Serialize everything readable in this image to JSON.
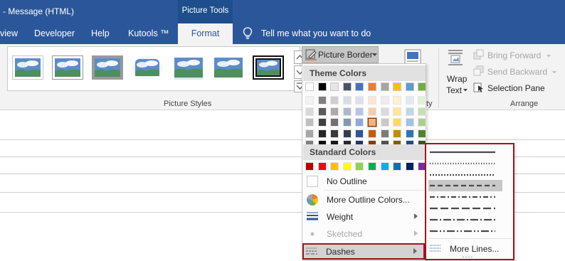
{
  "window": {
    "title": "- Message (HTML)"
  },
  "context_tab": {
    "label": "Picture Tools"
  },
  "tabs": [
    {
      "label": "view"
    },
    {
      "label": "Developer"
    },
    {
      "label": "Help"
    },
    {
      "label": "Kutools ™"
    },
    {
      "label": "Format"
    }
  ],
  "tell_me": {
    "label": "Tell me what you want to do"
  },
  "ribbon": {
    "picture_styles_label": "Picture Styles",
    "picture_border_label": "Picture Border",
    "y_partial_label": "ty",
    "wrap_text_label_1": "Wrap",
    "wrap_text_label_2": "Text",
    "bring_forward_label": "Bring Forward",
    "send_backward_label": "Send Backward",
    "selection_pane_label": "Selection Pane",
    "arrange_label": "Arrange"
  },
  "menu": {
    "theme_colors_label": "Theme Colors",
    "theme_top_row": [
      "#ffffff",
      "#000000",
      "#e7e6e6",
      "#44546a",
      "#4472c4",
      "#ed7d31",
      "#a5a5a5",
      "#ffc000",
      "#5b9bd5",
      "#70ad47"
    ],
    "theme_columns": [
      [
        "#f2f2f2",
        "#d9d9d9",
        "#bfbfbf",
        "#a6a6a6",
        "#808080"
      ],
      [
        "#808080",
        "#595959",
        "#404040",
        "#262626",
        "#0d0d0d"
      ],
      [
        "#d0cece",
        "#aeaaaa",
        "#757070",
        "#3a3838",
        "#161616"
      ],
      [
        "#d6dce4",
        "#acb9ca",
        "#8497b0",
        "#333f4f",
        "#222a35"
      ],
      [
        "#d9e1f2",
        "#b4c6e7",
        "#8ea9db",
        "#2f5597",
        "#1f3864"
      ],
      [
        "#fbe5d6",
        "#f8cbad",
        "#f4b183",
        "#c55a11",
        "#843c0c"
      ],
      [
        "#ededed",
        "#dbdbdb",
        "#c9c9c9",
        "#7b7b7b",
        "#525252"
      ],
      [
        "#fff2cc",
        "#ffe699",
        "#ffd966",
        "#bf9000",
        "#7f6000"
      ],
      [
        "#deebf7",
        "#bdd7ee",
        "#9dc3e6",
        "#2e75b6",
        "#1f4e79"
      ],
      [
        "#e2f0d9",
        "#c5e0b4",
        "#a9d18e",
        "#548235",
        "#385723"
      ]
    ],
    "standard_colors_label": "Standard Colors",
    "standard_colors": [
      "#c00000",
      "#ff0000",
      "#ffc000",
      "#ffff00",
      "#92d050",
      "#00b050",
      "#00b0f0",
      "#0070c0",
      "#002060",
      "#7030a0"
    ],
    "no_outline_label": "No Outline",
    "more_outline_colors_label": "More Outline Colors...",
    "weight_label": "Weight",
    "sketched_label": "Sketched",
    "dashes_label": "Dashes"
  },
  "dashes_menu": {
    "options": [
      "solid",
      "round-dot",
      "square-dot",
      "dash",
      "dash-dot",
      "long-dash",
      "long-dash-dot",
      "long-dash-dot-dot"
    ],
    "selected": "dash",
    "more_lines_label": "More Lines..."
  },
  "colors": {
    "ribbon_blue": "#2b579a",
    "highlight_red": "#a0171c",
    "ribbon_bg": "#f3f3f3"
  }
}
